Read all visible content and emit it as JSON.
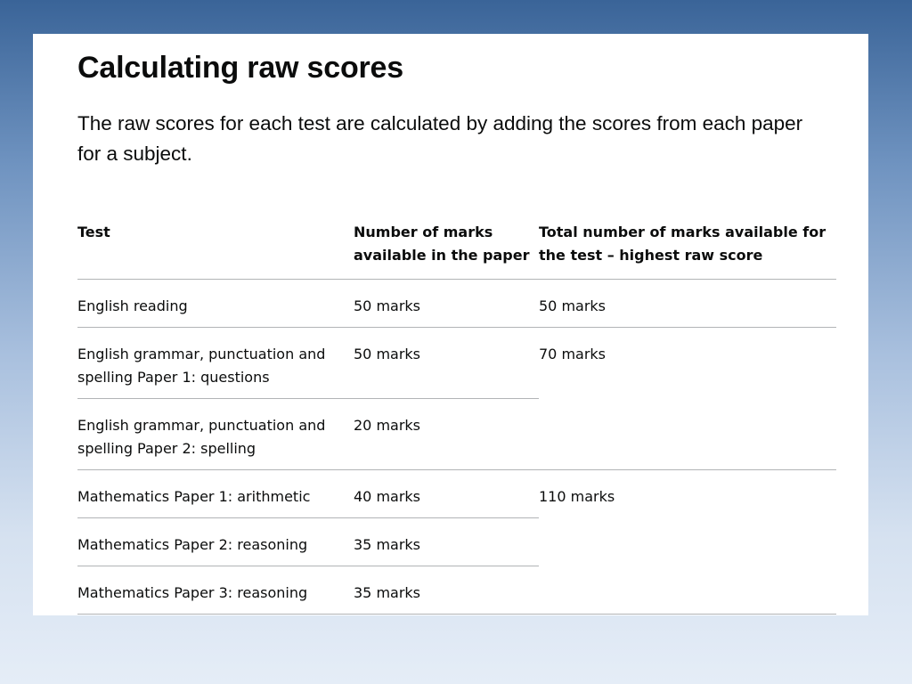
{
  "page": {
    "heading": "Calculating raw scores",
    "lead": "The raw scores for each test are calculated by adding the scores from each paper for a subject."
  },
  "table": {
    "headers": {
      "test_line1": "Test",
      "marks_line1": "Number of marks",
      "marks_line2": "available in the paper",
      "total_line1": "Total number of marks available for",
      "total_line2": "the test – highest raw score"
    },
    "rows": [
      {
        "test_line1": "English reading",
        "test_line2": "",
        "marks": "50 marks"
      },
      {
        "test_line1": "English grammar, punctuation and",
        "test_line2": "spelling Paper 1: questions",
        "marks": "50 marks"
      },
      {
        "test_line1": "English grammar, punctuation and",
        "test_line2": "spelling Paper 2: spelling",
        "marks": "20 marks"
      },
      {
        "test_line1": "Mathematics Paper 1: arithmetic",
        "test_line2": "",
        "marks": "40 marks"
      },
      {
        "test_line1": "Mathematics Paper 2: reasoning",
        "test_line2": "",
        "marks": "35 marks"
      },
      {
        "test_line1": "Mathematics Paper 3: reasoning",
        "test_line2": "",
        "marks": "35 marks"
      }
    ],
    "totals": [
      {
        "value": "50 marks"
      },
      {
        "value": "70 marks"
      },
      {
        "value": "110 marks"
      }
    ]
  }
}
